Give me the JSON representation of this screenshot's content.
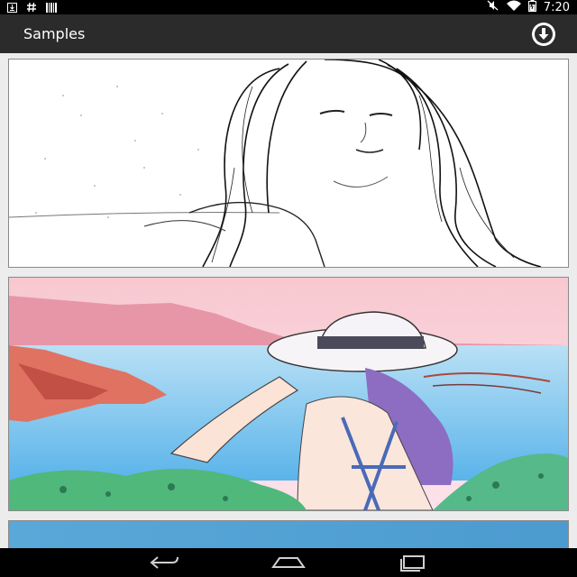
{
  "status_bar": {
    "time": "7:20",
    "left_icons": [
      "download-notification-icon",
      "hash-icon",
      "barcode-icon"
    ],
    "right_icons": [
      "mute-icon",
      "wifi-icon",
      "battery-icon"
    ]
  },
  "app_bar": {
    "title": "Samples",
    "action_icon": "download-circle-icon"
  },
  "samples": [
    {
      "style": "pencil-sketch",
      "subject": "woman-long-hair"
    },
    {
      "style": "watercolor-cartoon",
      "subject": "woman-sunhat-seaside"
    },
    {
      "style": "partial-blue",
      "subject": "sky"
    }
  ],
  "nav_bar": {
    "buttons": [
      "back-icon",
      "home-icon",
      "recents-icon"
    ]
  },
  "colors": {
    "status_bar": "#000000",
    "app_bar": "#2b2b2b",
    "background": "#ececec",
    "card_border": "#8a8a8a"
  }
}
